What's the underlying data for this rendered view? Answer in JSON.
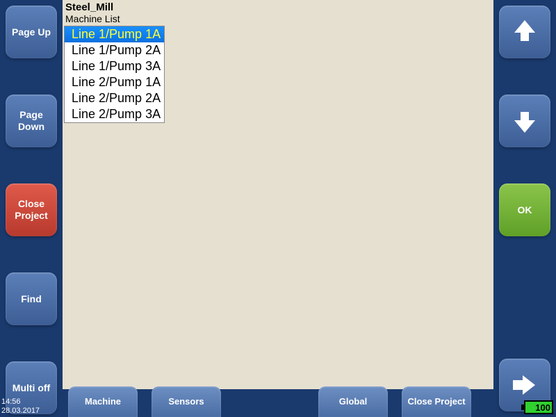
{
  "left": {
    "page_up": "Page Up",
    "page_down": "Page Down",
    "close_project": "Close Project",
    "find": "Find",
    "multi_off": "Multi off"
  },
  "right": {
    "ok": "OK"
  },
  "bottom": {
    "machine": "Machine",
    "sensors": "Sensors",
    "global": "Global",
    "close_project": "Close Project"
  },
  "project": {
    "title": "Steel_Mill",
    "list_label": "Machine List",
    "items": [
      {
        "label": "Line 1/Pump 1A",
        "selected": true
      },
      {
        "label": "Line 1/Pump 2A",
        "selected": false
      },
      {
        "label": "Line 1/Pump 3A",
        "selected": false
      },
      {
        "label": "Line 2/Pump 1A",
        "selected": false
      },
      {
        "label": "Line 2/Pump 2A",
        "selected": false
      },
      {
        "label": "Line 2/Pump 3A",
        "selected": false
      }
    ]
  },
  "status": {
    "time": "14:56",
    "date": "28.03.2017",
    "battery": "100"
  }
}
